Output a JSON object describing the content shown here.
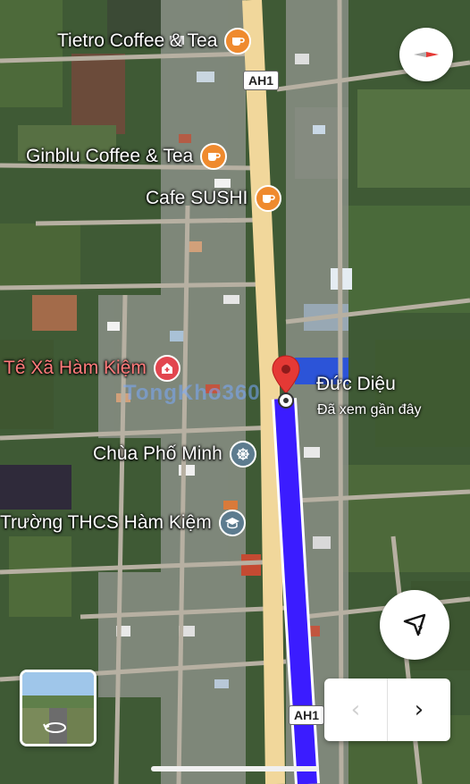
{
  "map": {
    "road_shield": "AH1",
    "pois": [
      {
        "label": "Tietro Coffee & Tea",
        "icon": "coffee-icon",
        "color": "#ef8a2e"
      },
      {
        "label": "Ginblu Coffee & Tea",
        "icon": "coffee-icon",
        "color": "#ef8a2e"
      },
      {
        "label": "Cafe SUSHI",
        "icon": "coffee-icon",
        "color": "#ef8a2e"
      },
      {
        "label": "Tế Xã Hàm Kiệm",
        "icon": "hospital-icon",
        "color": "#e2464f"
      },
      {
        "label": "Chùa Phố Minh",
        "icon": "temple-icon",
        "color": "#5d7c8f"
      },
      {
        "label": "Trường THCS Hàm Kiệm",
        "icon": "school-icon",
        "color": "#5d7c8f"
      }
    ],
    "selected_place": {
      "name": "Đức Diệu",
      "status": "Đã xem gần đây",
      "marker_color": "#e53935"
    },
    "route_color": "#3b1cff",
    "road_color": "#f1d79b",
    "watermark": "TongKho360"
  },
  "controls": {
    "compass_icon": "compass-icon",
    "locate_icon": "navigate-question-icon",
    "street_view_icon": "street-view-rotate-icon",
    "prev_label": "‹",
    "next_label": "›"
  }
}
